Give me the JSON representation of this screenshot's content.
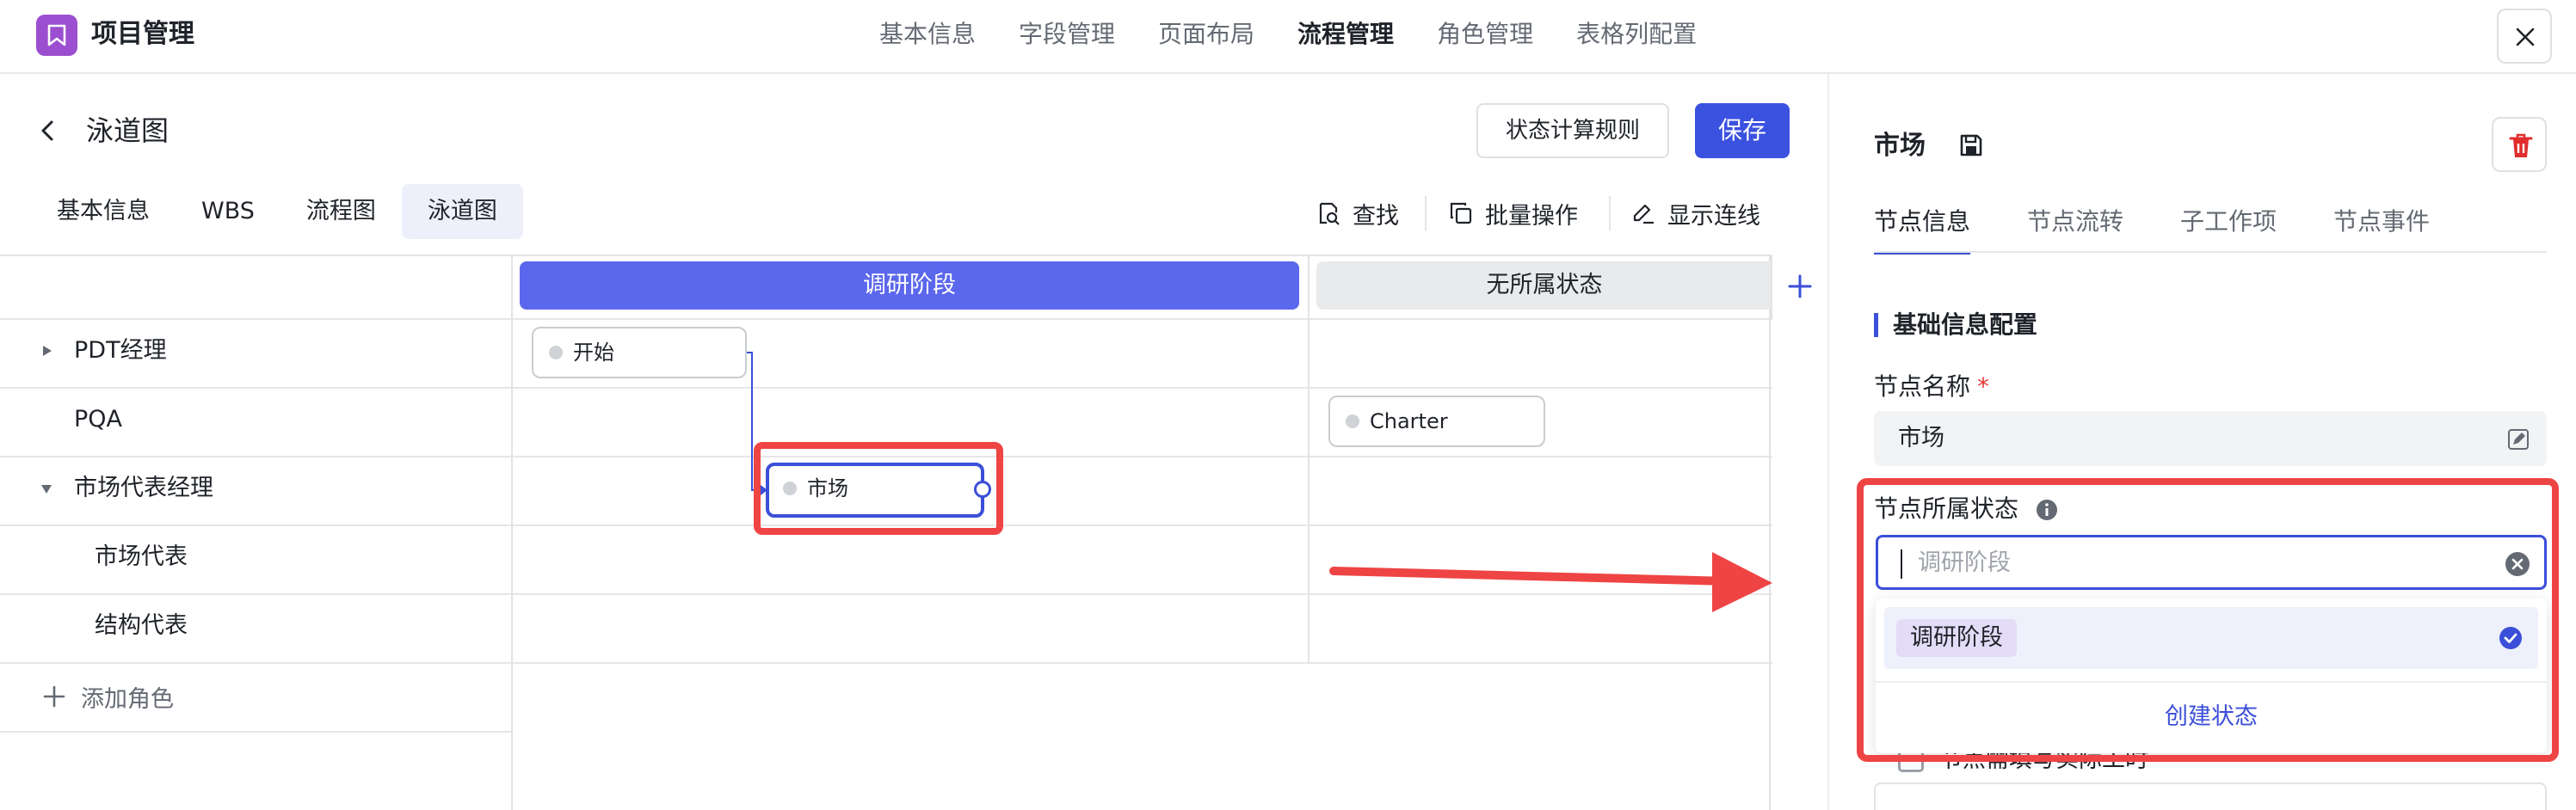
{
  "app": {
    "title": "项目管理"
  },
  "top_nav": [
    {
      "label": "基本信息",
      "active": false
    },
    {
      "label": "字段管理",
      "active": false
    },
    {
      "label": "页面布局",
      "active": false
    },
    {
      "label": "流程管理",
      "active": true
    },
    {
      "label": "角色管理",
      "active": false
    },
    {
      "label": "表格列配置",
      "active": false
    }
  ],
  "page": {
    "title": "泳道图",
    "rule_button": "状态计算规则",
    "save_button": "保存"
  },
  "view_tabs": [
    {
      "label": "基本信息",
      "active": false
    },
    {
      "label": "WBS",
      "active": false
    },
    {
      "label": "流程图",
      "active": false
    },
    {
      "label": "泳道图",
      "active": true
    }
  ],
  "toolbar": {
    "find": "查找",
    "batch": "批量操作",
    "show_lines": "显示连线"
  },
  "stages": [
    {
      "label": "调研阶段",
      "color": "#5b67ec"
    },
    {
      "label": "无所属状态",
      "color": "#e9eaec"
    }
  ],
  "lanes": [
    {
      "label": "PDT经理",
      "expandable": true,
      "expanded": false
    },
    {
      "label": "PQA",
      "expandable": false
    },
    {
      "label": "市场代表经理",
      "expandable": true,
      "expanded": true
    },
    {
      "label": "市场代表",
      "expandable": false
    },
    {
      "label": "结构代表",
      "expandable": false
    }
  ],
  "add_role": "添加角色",
  "nodes": [
    {
      "label": "开始",
      "lane": "PDT经理",
      "stage": "调研阶段",
      "selected": false
    },
    {
      "label": "Charter",
      "lane": "PQA",
      "stage": "无所属状态",
      "selected": false
    },
    {
      "label": "市场",
      "lane": "市场代表经理",
      "stage": "调研阶段",
      "selected": true
    }
  ],
  "panel": {
    "title": "市场",
    "tabs": [
      {
        "label": "节点信息",
        "active": true
      },
      {
        "label": "节点流转",
        "active": false
      },
      {
        "label": "子工作项",
        "active": false
      },
      {
        "label": "节点事件",
        "active": false
      }
    ],
    "section_title": "基础信息配置",
    "name_label": "节点名称",
    "required_mark": "*",
    "name_value": "市场",
    "state_label": "节点所属状态",
    "state_placeholder": "调研阶段",
    "dropdown": {
      "options": [
        {
          "label": "调研阶段",
          "selected": true
        }
      ],
      "create_label": "创建状态"
    },
    "partial_checkbox_label": "节点需填写实际工时"
  },
  "colors": {
    "primary": "#3b52e0",
    "accent_stage": "#5b67ec",
    "highlight_red": "#ef4444",
    "logo": "#9b4fd0"
  }
}
